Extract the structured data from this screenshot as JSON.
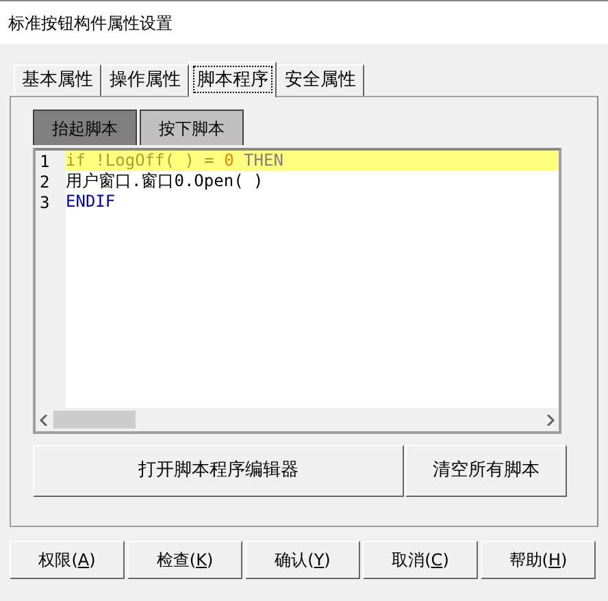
{
  "window": {
    "title": "标准按钮构件属性设置"
  },
  "tabs": [
    {
      "label": "基本属性",
      "selected": false
    },
    {
      "label": "操作属性",
      "selected": false
    },
    {
      "label": "脚本程序",
      "selected": true
    },
    {
      "label": "安全属性",
      "selected": false
    }
  ],
  "script_tabs": [
    {
      "label": "抬起脚本",
      "selected": true
    },
    {
      "label": "按下脚本",
      "selected": false
    }
  ],
  "editor": {
    "lines": [
      {
        "number": "1",
        "highlighted": true,
        "tokens": [
          {
            "text": "if !LogOff( ) = ",
            "color": "#a8a030"
          },
          {
            "text": "0",
            "color": "#f08000"
          },
          {
            "text": " THEN",
            "color": "#808080"
          }
        ]
      },
      {
        "number": "2",
        "highlighted": false,
        "tokens": [
          {
            "text": "用户窗口.窗口0.Open( )",
            "color": "#000000"
          }
        ]
      },
      {
        "number": "3",
        "highlighted": false,
        "tokens": [
          {
            "text": "ENDIF",
            "color": "#0000c0"
          }
        ]
      }
    ]
  },
  "actions": [
    "打开脚本程序编辑器",
    "清空所有脚本"
  ],
  "buttons": [
    {
      "before": "权限(",
      "accel": "A",
      "after": ")"
    },
    {
      "before": "检查(",
      "accel": "K",
      "after": ")"
    },
    {
      "before": "确认(",
      "accel": "Y",
      "after": ")"
    },
    {
      "before": "取消(",
      "accel": "C",
      "after": ")"
    },
    {
      "before": "帮助(",
      "accel": "H",
      "after": ")"
    }
  ]
}
